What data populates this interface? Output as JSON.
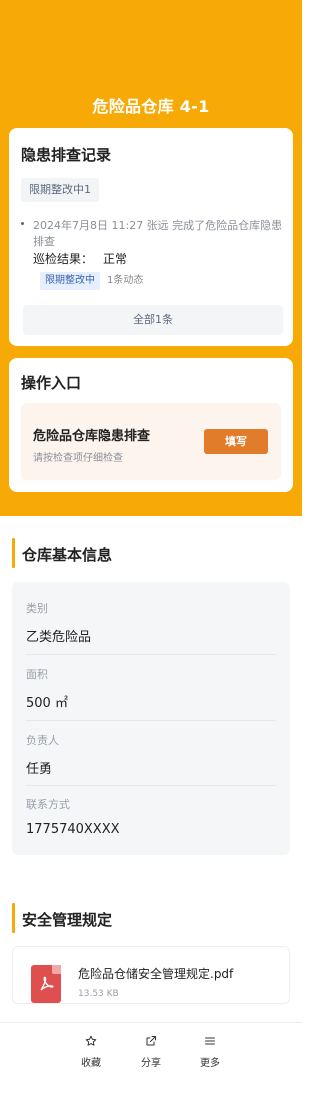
{
  "header": {
    "title": "危险品仓库 4-1"
  },
  "hazard_record": {
    "title": "隐患排查记录",
    "status_tag": "限期整改中1",
    "log": {
      "text": "2024年7月8日 11:27  张远  完成了危险品仓库隐患排查",
      "result_label": "巡检结果：",
      "result_value": "正常",
      "status_tag": "限期整改中",
      "count_text": "1条动态"
    },
    "all_button": "全部1条"
  },
  "operation": {
    "title": "操作入口",
    "task_name": "危险品仓库隐患排查",
    "task_hint": "请按检查项仔细检查",
    "fill_button": "填写"
  },
  "warehouse_info": {
    "title": "仓库基本信息",
    "fields": [
      {
        "label": "类别",
        "value": "乙类危险品"
      },
      {
        "label": "面积",
        "value": "500 ㎡"
      },
      {
        "label": "负责人",
        "value": "任勇"
      },
      {
        "label": "联系方式",
        "value": "1775740XXXX"
      }
    ]
  },
  "regulations": {
    "title": "安全管理规定",
    "file": {
      "name": "危险品仓储安全管理规定.pdf",
      "size": "13.53 KB",
      "icon": "pdf-icon"
    }
  },
  "bottom_bar": {
    "items": [
      {
        "label": "收藏",
        "icon": "star-icon"
      },
      {
        "label": "分享",
        "icon": "share-icon"
      },
      {
        "label": "更多",
        "icon": "menu-icon"
      }
    ]
  },
  "colors": {
    "accent": "#f7aa05",
    "button": "#e17c2a",
    "pdf": "#e04f4f"
  }
}
